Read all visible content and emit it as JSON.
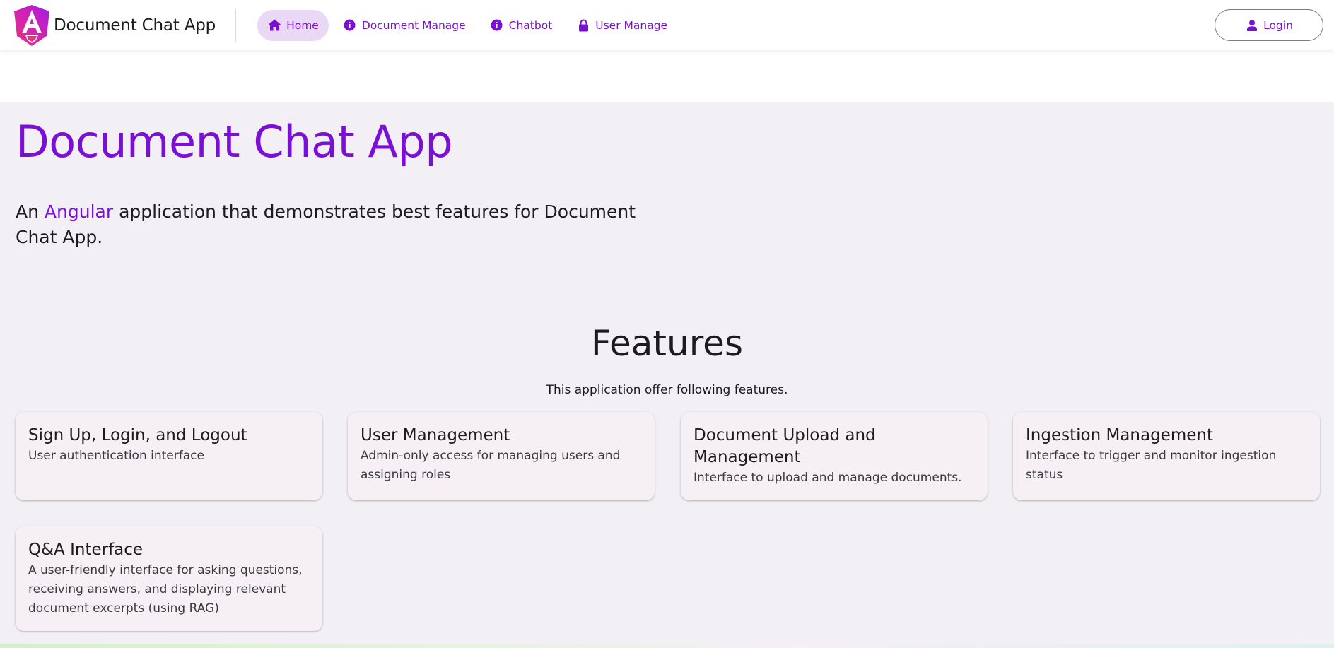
{
  "app": {
    "name": "Document Chat App"
  },
  "nav": {
    "items": [
      {
        "label": "Home",
        "icon": "home-icon",
        "active": true
      },
      {
        "label": "Document Manage",
        "icon": "info-icon",
        "active": false
      },
      {
        "label": "Chatbot",
        "icon": "info-icon",
        "active": false
      },
      {
        "label": "User Manage",
        "icon": "lock-icon",
        "active": false
      }
    ],
    "login_label": "Login",
    "login_icon": "person-icon"
  },
  "hero": {
    "title": "Document Chat App",
    "desc_prefix": "An ",
    "desc_highlight": "Angular",
    "desc_suffix": " application that demonstrates best features for Document Chat App."
  },
  "features": {
    "title": "Features",
    "subtitle": "This application offer following features.",
    "cards": [
      {
        "title": "Sign Up, Login, and Logout",
        "text": "User authentication interface"
      },
      {
        "title": "User Management",
        "text": "Admin-only access for managing users and assigning roles"
      },
      {
        "title": "Document Upload and Management",
        "text": "Interface to upload and manage documents."
      },
      {
        "title": "Ingestion Management",
        "text": "Interface to trigger and monitor ingestion status"
      },
      {
        "title": "Q&A Interface",
        "text": "A user-friendly interface for asking questions, receiving answers, and displaying relevant document excerpts (using RAG)"
      }
    ]
  },
  "colors": {
    "accent": "#7b0fd6",
    "active_nav_bg": "#ead9f6",
    "content_bg": "#f2f0f5",
    "card_bg": "#f6f0f4",
    "logo_pink": "#e8347a",
    "logo_magenta": "#c21cd0"
  }
}
